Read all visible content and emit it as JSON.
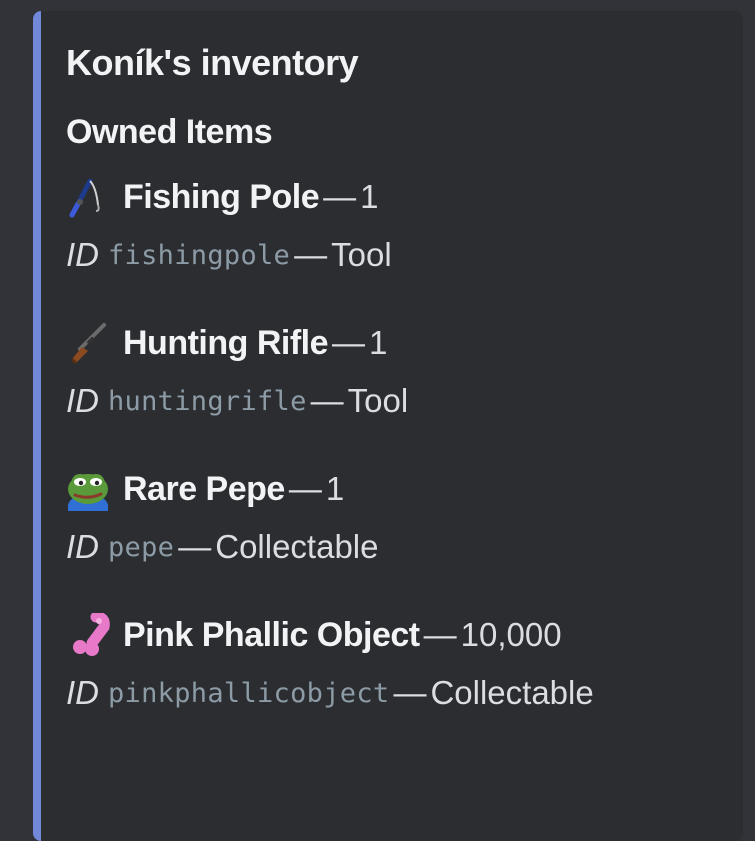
{
  "embed": {
    "title": "Koník's inventory",
    "field_name": "Owned Items",
    "accent_color": "#7289da",
    "separator": "—",
    "id_label": "ID",
    "items": [
      {
        "icon": "fishing-pole-icon",
        "name": "Fishing Pole",
        "quantity": "1",
        "id": "fishingpole",
        "category": "Tool"
      },
      {
        "icon": "hunting-rifle-icon",
        "name": "Hunting Rifle",
        "quantity": "1",
        "id": "huntingrifle",
        "category": "Tool"
      },
      {
        "icon": "rare-pepe-icon",
        "name": "Rare Pepe",
        "quantity": "1",
        "id": "pepe",
        "category": "Collectable"
      },
      {
        "icon": "pink-phallic-object-icon",
        "name": "Pink Phallic Object",
        "quantity": "10,000",
        "id": "pinkphallicobject",
        "category": "Collectable"
      }
    ]
  }
}
